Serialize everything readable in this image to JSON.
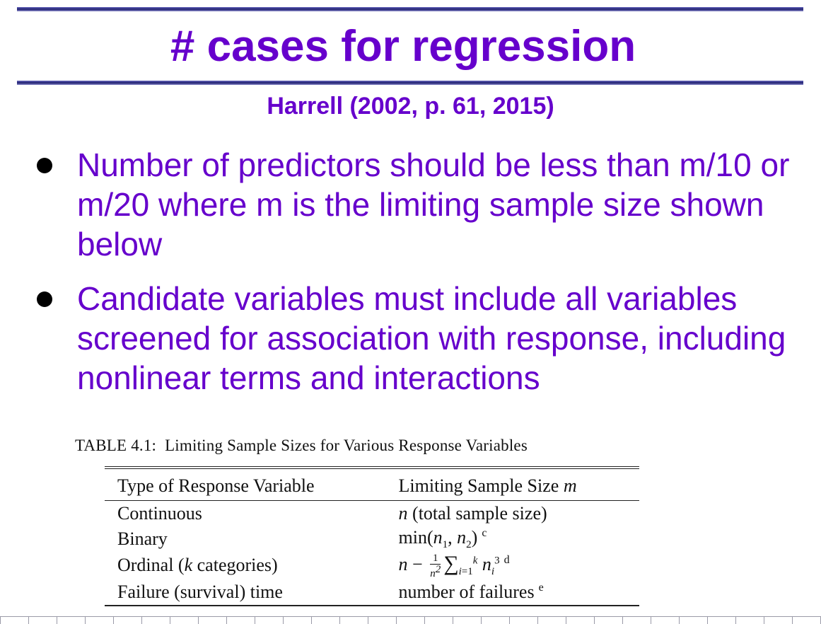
{
  "slide": {
    "title": "# cases for regression",
    "subtitle": "Harrell (2002, p. 61, 2015)",
    "bullets": [
      "Number of predictors should be less than m/10 or m/20 where m is the limiting sample size shown below",
      "Candidate variables must include all variables screened for association with response, including nonlinear terms and interactions"
    ]
  },
  "table": {
    "caption_label": "TABLE 4.1:",
    "caption_text": "Limiting Sample Sizes for Various Response Variables",
    "headers": [
      "Type of Response Variable",
      "Limiting Sample Size"
    ],
    "header_var": "m",
    "rows": [
      {
        "type": "Continuous",
        "n_var": "n",
        "limit_text": "(total sample size)",
        "note": ""
      },
      {
        "type": "Binary",
        "limit_text": "min(",
        "note": "c"
      },
      {
        "type_prefix": "Ordinal (",
        "type_var": "k",
        "type_suffix": "categories)",
        "note": "d"
      },
      {
        "type": "Failure (survival) time",
        "limit_text": "number of failures",
        "note": "e"
      }
    ]
  },
  "colors": {
    "accent": "#6600cc",
    "rule": "#1e1e6e"
  }
}
